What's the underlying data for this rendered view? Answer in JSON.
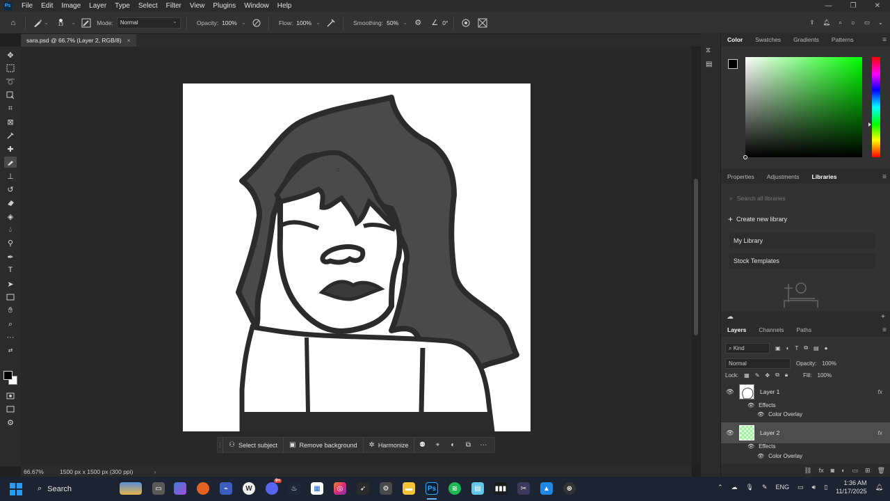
{
  "menubar": {
    "app_logo": "Ps",
    "items": [
      "File",
      "Edit",
      "Image",
      "Layer",
      "Type",
      "Select",
      "Filter",
      "View",
      "Plugins",
      "Window",
      "Help"
    ],
    "window_controls": [
      "—",
      "❐",
      "✕"
    ]
  },
  "options_bar": {
    "brush_size": "13",
    "mode_label": "Mode:",
    "mode_value": "Normal",
    "opacity_label": "Opacity:",
    "opacity_value": "100%",
    "flow_label": "Flow:",
    "flow_value": "100%",
    "smoothing_label": "Smoothing:",
    "smoothing_value": "50%",
    "angle_value": "0°"
  },
  "document": {
    "tab_title": "sara.psd @ 66.7% (Layer 2, RGB/8)",
    "close": "×"
  },
  "status": {
    "zoom": "66.67%",
    "dimensions": "1500 px x 1500 px (300 ppi)",
    "arrow": "›"
  },
  "contextual_bar": {
    "select_subject": "Select subject",
    "remove_background": "Remove background",
    "harmonize": "Harmonize",
    "more": "···"
  },
  "color_panel": {
    "tabs": [
      "Color",
      "Swatches",
      "Gradients",
      "Patterns"
    ],
    "active_tab": "Color",
    "foreground": "#000000",
    "background": "#ffffff",
    "hue_marker": "#00ff00"
  },
  "libraries_panel": {
    "tabs": [
      "Properties",
      "Adjustments",
      "Libraries"
    ],
    "active_tab": "Libraries",
    "search_placeholder": "Search all libraries",
    "create_label": "Create new library",
    "items": [
      "My Library",
      "Stock Templates"
    ]
  },
  "layers_panel": {
    "tabs": [
      "Layers",
      "Channels",
      "Paths"
    ],
    "active_tab": "Layers",
    "filter_kind": "Kind",
    "blend_mode": "Normal",
    "opacity_label": "Opacity:",
    "opacity_value": "100%",
    "lock_label": "Lock:",
    "fill_label": "Fill:",
    "fill_value": "100%",
    "layers": [
      {
        "name": "Layer 1",
        "effects_label": "Effects",
        "effect": "Color Overlay",
        "fx": "fx",
        "selected": false
      },
      {
        "name": "Layer 2",
        "effects_label": "Effects",
        "effect": "Color Overlay",
        "fx": "fx",
        "selected": true
      }
    ]
  },
  "taskbar": {
    "search_label": "Search",
    "discord_badge": "9+",
    "language": "ENG",
    "time": "1:36 AM",
    "date": "11/17/2025"
  },
  "colors": {
    "accent": "#31a8ff",
    "panel_bg": "#323232",
    "workspace_bg": "#282828",
    "hair_fill": "#4a4a4a"
  }
}
